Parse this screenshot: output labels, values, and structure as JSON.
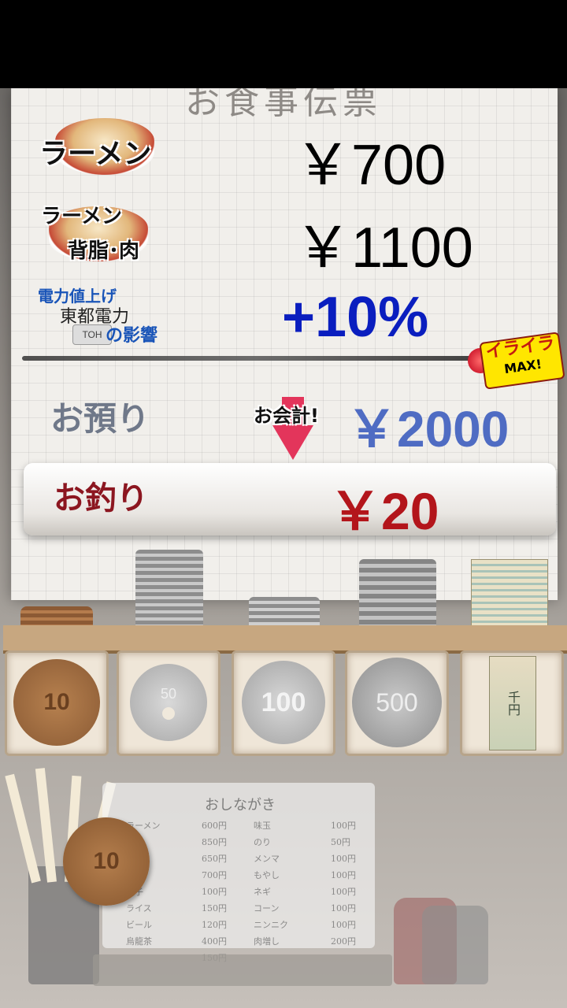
{
  "receipt": {
    "title": "お食事伝票",
    "ramen_label": "ラーメン",
    "ramen_price": "￥700",
    "special_label_top": "ラーメン",
    "special_label_bottom": "背脂･肉",
    "special_price": "￥1100",
    "power_label_top": "電力値上げ",
    "power_label_mid": "東都電力",
    "power_label_bottom": "の影響",
    "power_label_logo": "TOH",
    "surcharge": "+10%",
    "deposit_label": "お預り",
    "checkout_label": "お会計!",
    "deposit_amount": "￥2000",
    "change_label": "お釣り",
    "change_amount": "￥20",
    "badge_text": "イライラ",
    "badge_sub": "MAX!"
  },
  "money": {
    "coin_10": "10",
    "coin_50": "50",
    "coin_100": "100",
    "coin_500": "500",
    "bill_1000": "千円"
  },
  "menu": {
    "title": "おしながき",
    "left_items": [
      "ラーメン",
      "",
      "",
      "",
      "餃子",
      "ライス",
      "",
      "ビール",
      "烏龍茶"
    ],
    "left_prices": [
      "600円",
      "850円",
      "650円",
      "700円",
      "100円",
      "150円",
      "120円",
      "400円",
      "150円"
    ],
    "right_items": [
      "味玉",
      "のり",
      "メンマ",
      "もやし",
      "ネギ",
      "コーン",
      "ニンニク",
      "肉増し"
    ],
    "right_prices": [
      "100円",
      "50円",
      "100円",
      "100円",
      "100円",
      "100円",
      "100円",
      "200円"
    ]
  },
  "colors": {
    "price_black": "#000000",
    "surcharge_blue": "#0a1ebf",
    "deposit_blue": "#4f6cc3",
    "change_red": "#b3151b"
  }
}
